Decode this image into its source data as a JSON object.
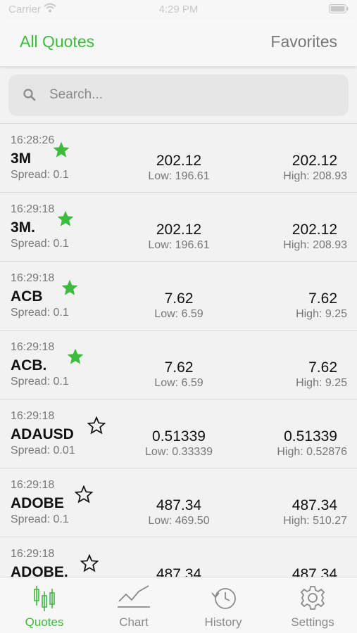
{
  "status_bar": {
    "carrier": "Carrier",
    "time": "4:29 PM"
  },
  "top_tabs": {
    "all_quotes": "All Quotes",
    "favorites": "Favorites"
  },
  "search": {
    "placeholder": "Search..."
  },
  "quotes": [
    {
      "time": "16:28:26",
      "symbol": "3M",
      "spread": "Spread: 0.1",
      "bid": "202.12",
      "low": "Low: 196.61",
      "ask": "202.12",
      "high": "High: 208.93",
      "favorite": true
    },
    {
      "time": "16:29:18",
      "symbol": "3M.",
      "spread": "Spread: 0.1",
      "bid": "202.12",
      "low": "Low: 196.61",
      "ask": "202.12",
      "high": "High: 208.93",
      "favorite": true
    },
    {
      "time": "16:29:18",
      "symbol": "ACB",
      "spread": "Spread: 0.1",
      "bid": "7.62",
      "low": "Low: 6.59",
      "ask": "7.62",
      "high": "High: 9.25",
      "favorite": true
    },
    {
      "time": "16:29:18",
      "symbol": "ACB.",
      "spread": "Spread: 0.1",
      "bid": "7.62",
      "low": "Low: 6.59",
      "ask": "7.62",
      "high": "High: 9.25",
      "favorite": true
    },
    {
      "time": "16:29:18",
      "symbol": "ADAUSD",
      "spread": "Spread: 0.01",
      "bid": "0.51339",
      "low": "Low: 0.33339",
      "ask": "0.51339",
      "high": "High: 0.52876",
      "favorite": false
    },
    {
      "time": "16:29:18",
      "symbol": "ADOBE",
      "spread": "Spread: 0.1",
      "bid": "487.34",
      "low": "Low: 469.50",
      "ask": "487.34",
      "high": "High: 510.27",
      "favorite": false
    },
    {
      "time": "16:29:18",
      "symbol": "ADOBE.",
      "spread": "",
      "bid": "487.34",
      "low": "",
      "ask": "487.34",
      "high": "",
      "favorite": false
    }
  ],
  "tabbar": {
    "quotes": "Quotes",
    "chart": "Chart",
    "history": "History",
    "settings": "Settings"
  },
  "colors": {
    "accent": "#3dbb3d",
    "favorite_star": "#3dbb3d",
    "muted_text": "#777777"
  },
  "icons": {
    "search": "search-icon",
    "favorite_on": "star-filled-icon",
    "favorite_off": "star-outline-icon",
    "quotes_tab": "candlestick-icon",
    "chart_tab": "line-chart-icon",
    "history_tab": "history-clock-icon",
    "settings_tab": "gear-icon"
  }
}
